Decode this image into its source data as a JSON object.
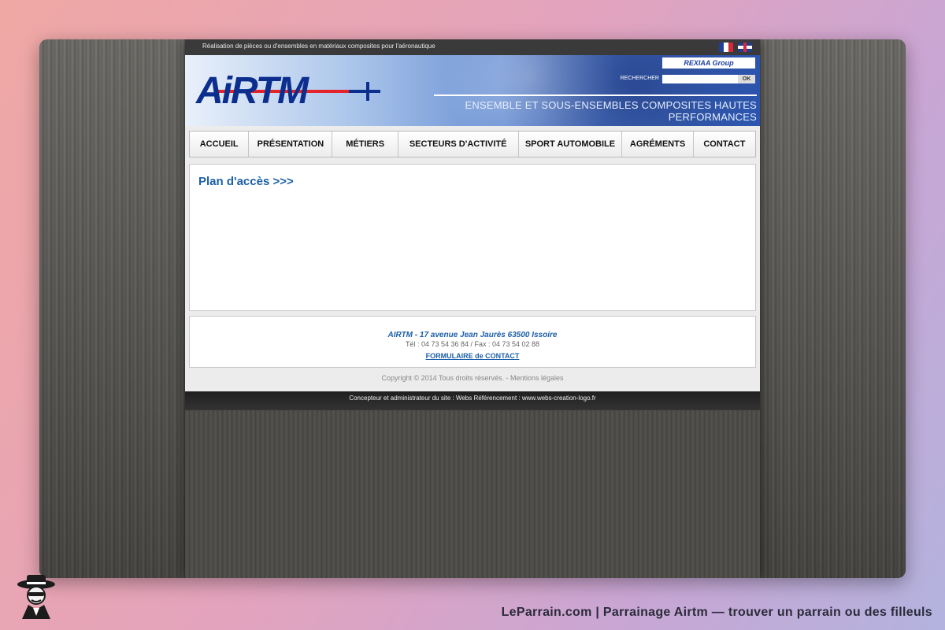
{
  "site": {
    "top_tagline": "Réalisation de pièces ou d'ensembles en matériaux composites pour l'aéronautique",
    "logo_text": "AiRTM",
    "group_badge": "REXIAA Group",
    "search": {
      "label": "RECHERCHER",
      "value": "",
      "placeholder": "",
      "button": "OK"
    },
    "banner_tagline": "ENSEMBLE ET SOUS-ENSEMBLES COMPOSITES HAUTES PERFORMANCES",
    "nav": [
      {
        "label": "ACCUEIL"
      },
      {
        "label": "PRÉSENTATION"
      },
      {
        "label": "MÉTIERS"
      },
      {
        "label": "SECTEURS D'ACTIVITÉ"
      },
      {
        "label": "SPORT AUTOMOBILE"
      },
      {
        "label": "AGRÉMENTS"
      },
      {
        "label": "CONTACT"
      }
    ],
    "content_title": "Plan d'accès >>>",
    "footer": {
      "address": "AIRTM - 17 avenue Jean Jaurès 63500 Issoire",
      "tel": "Tél : 04 73 54 36 84 / Fax : 04 73 54 02 88",
      "contact_link": "FORMULAIRE de CONTACT"
    },
    "copyright": "Copyright © 2014 Tous droits réservés. - Mentions légales",
    "designer": "Concepteur et administrateur du site : Webs Référencement : www.webs-creation-logo.fr"
  },
  "brand": {
    "caption": "LeParrain.com | Parrainage Airtm — trouver un parrain ou des filleuls"
  },
  "colors": {
    "link_blue": "#1c5fa7",
    "logo_blue": "#0c2f8f",
    "logo_red": "#e3242b"
  }
}
